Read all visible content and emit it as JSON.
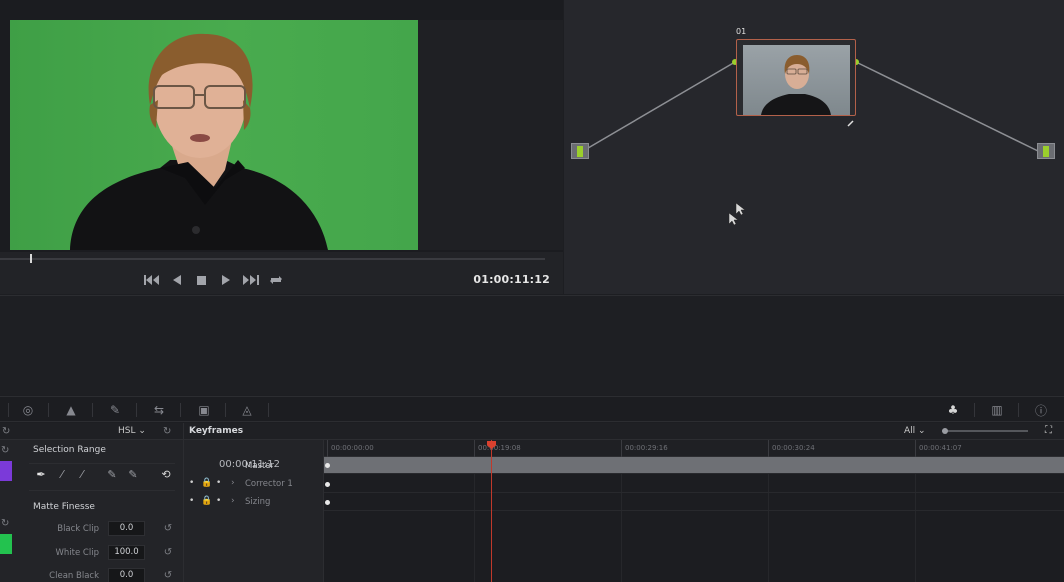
{
  "viewer": {
    "timecode": "01:00:11:12",
    "scrub_progress": 0.055,
    "transport": {
      "first": "skip-to-start-icon",
      "prev": "play-reverse-icon",
      "stop": "stop-icon",
      "play": "play-icon",
      "last": "skip-to-end-icon",
      "loop": "loop-icon"
    }
  },
  "node_editor": {
    "node_label": "01"
  },
  "toolbar": {
    "icons": [
      "circle-icon",
      "color-warper-icon",
      "wand-icon",
      "tracker-icon",
      "3d-icon",
      "sizing-icon",
      "keyframe-icon",
      "scope-icon",
      "info-icon"
    ]
  },
  "qualifier": {
    "mode": "HSL",
    "selection_range_title": "Selection Range",
    "matte_finesse_title": "Matte Finesse",
    "rows": [
      {
        "label": "Black Clip",
        "value": "0.0"
      },
      {
        "label": "White Clip",
        "value": "100.0"
      },
      {
        "label": "Clean Black",
        "value": "0.0"
      }
    ],
    "colors": {
      "swatch_top": "#7b3ad9",
      "swatch_bottom": "#23c24f"
    }
  },
  "keyframes": {
    "title": "Keyframes",
    "filter": "All",
    "timecode": "00:00:11:12",
    "tracks": [
      {
        "name": "Master"
      },
      {
        "name": "Corrector 1"
      },
      {
        "name": "Sizing"
      }
    ],
    "ruler": [
      "00:00:00:00",
      "00:00:19:08",
      "00:00:29:16",
      "00:00:30:24",
      "00:00:41:07"
    ],
    "playhead_tc": "00:00:11:12"
  }
}
